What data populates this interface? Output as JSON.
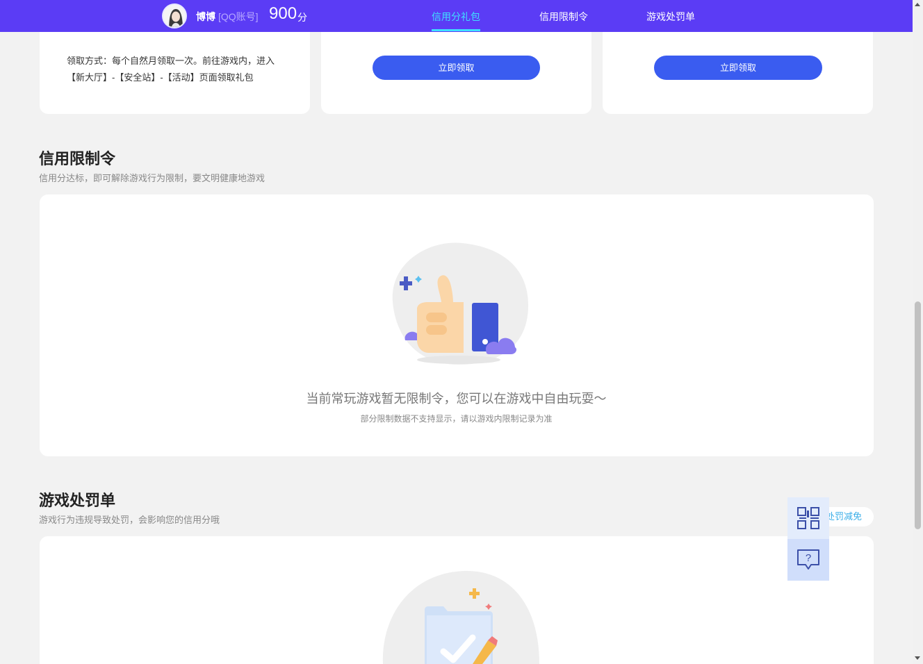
{
  "header": {
    "user_name": "博博",
    "account_type": "[QQ账号]",
    "score": "900",
    "score_unit": "分",
    "tabs": [
      {
        "label": "信用分礼包",
        "active": true
      },
      {
        "label": "信用限制令",
        "active": false
      },
      {
        "label": "游戏处罚单",
        "active": false
      }
    ]
  },
  "gift_cards": {
    "card1_text": "领取方式：每个自然月领取一次。前往游戏内，进入【新大厅】-【安全站】-【活动】页面领取礼包",
    "card2_button": "立即领取",
    "card3_button": "立即领取"
  },
  "restriction": {
    "title": "信用限制令",
    "subtitle": "信用分达标，即可解除游戏行为限制，要文明健康地游戏",
    "empty_main": "当前常玩游戏暂无限制令，您可以在游戏中自由玩耍～",
    "empty_sub": "部分限制数据不支持显示，请以游戏内限制记录为准"
  },
  "penalty": {
    "title": "游戏处罚单",
    "subtitle": "游戏行为违规导致处罚，会影响您的信用分哦",
    "reduce_label": "处罚减免"
  },
  "floating": {
    "qr_icon": "qrcode-icon",
    "help_icon": "help-chat-icon"
  },
  "colors": {
    "brand": "#5b3cf5",
    "button": "#3a5cf0",
    "active_tab": "#3fe0ff",
    "accent_link": "#3aaee8"
  }
}
